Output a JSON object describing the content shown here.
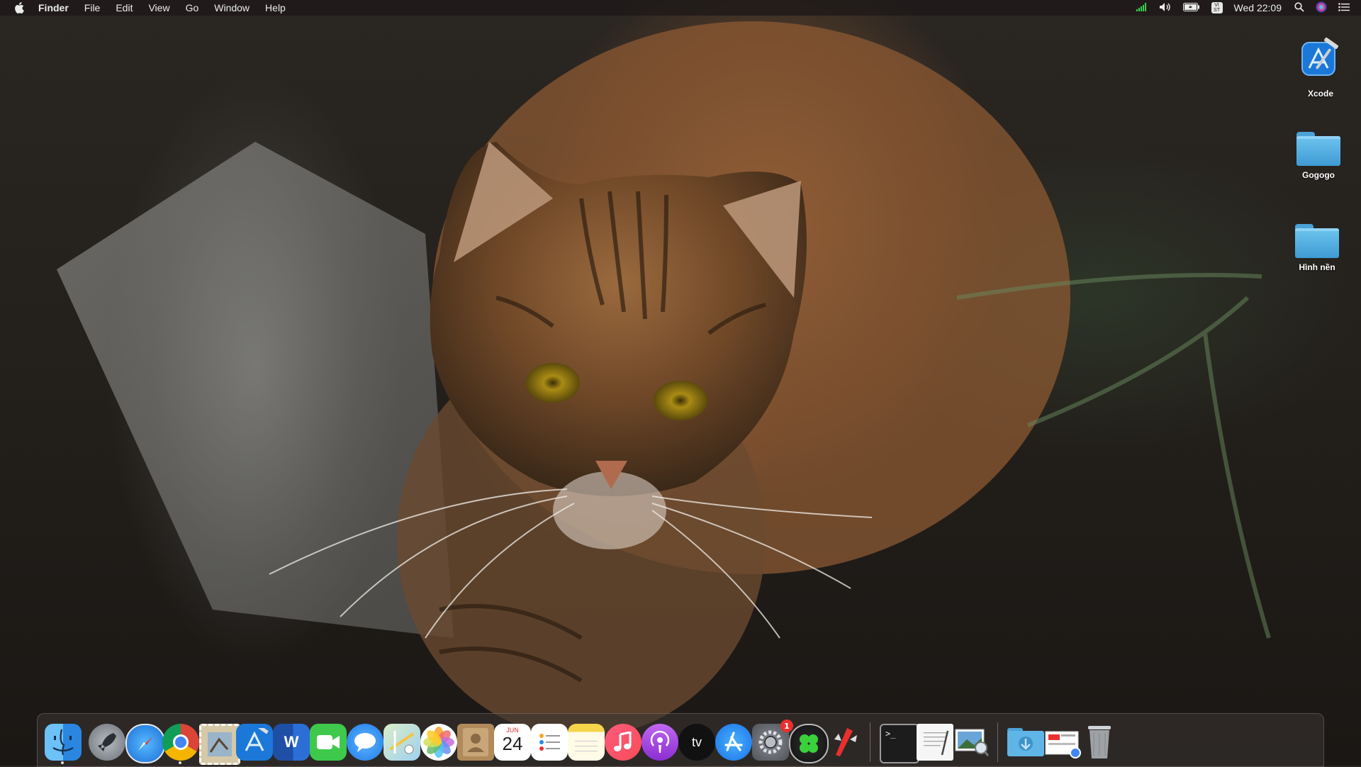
{
  "menubar": {
    "app_name": "Finder",
    "menus": [
      "File",
      "Edit",
      "View",
      "Go",
      "Window",
      "Help"
    ],
    "input_source": "VI ST",
    "clock": "Wed 22:09",
    "status_icons": [
      "wifi-signal-icon",
      "volume-icon",
      "battery-icon",
      "input-source-icon",
      "spotlight-icon",
      "siri-icon",
      "notification-center-icon"
    ]
  },
  "desktop": {
    "wallpaper": "Long-haired tabby cat crouching in dark grass",
    "icons": [
      {
        "label": "Xcode",
        "icon": "xcode-icon"
      },
      {
        "label": "Gogogo",
        "icon": "folder-icon"
      },
      {
        "label": "Hình nền",
        "icon": "folder-icon"
      }
    ]
  },
  "dock": {
    "apps": [
      {
        "name": "Finder",
        "icon": "finder-icon",
        "running": true
      },
      {
        "name": "Launchpad",
        "icon": "launchpad-icon"
      },
      {
        "name": "Safari",
        "icon": "safari-icon"
      },
      {
        "name": "Google Chrome",
        "icon": "chrome-icon",
        "running": true
      },
      {
        "name": "Mail Stamp",
        "icon": "stamp-icon"
      },
      {
        "name": "Xcode",
        "icon": "xcode-icon"
      },
      {
        "name": "Microsoft Word",
        "icon": "word-icon",
        "glyph": "W"
      },
      {
        "name": "FaceTime",
        "icon": "facetime-icon"
      },
      {
        "name": "Messages",
        "icon": "messages-icon"
      },
      {
        "name": "Maps",
        "icon": "maps-icon"
      },
      {
        "name": "Photos",
        "icon": "photos-icon"
      },
      {
        "name": "Contacts",
        "icon": "contacts-icon"
      },
      {
        "name": "Calendar",
        "icon": "calendar-icon",
        "month": "JUN",
        "day": "24"
      },
      {
        "name": "Reminders",
        "icon": "reminders-icon"
      },
      {
        "name": "Notes",
        "icon": "notes-icon"
      },
      {
        "name": "Music",
        "icon": "music-icon"
      },
      {
        "name": "Podcasts",
        "icon": "podcasts-icon"
      },
      {
        "name": "TV",
        "icon": "apple-tv-icon",
        "glyph": "tv"
      },
      {
        "name": "App Store",
        "icon": "app-store-icon"
      },
      {
        "name": "System Preferences",
        "icon": "system-preferences-icon",
        "badge": "1"
      },
      {
        "name": "Clover Configurator",
        "icon": "clover-icon"
      },
      {
        "name": "Kext Utility",
        "icon": "red-tool-icon"
      },
      {
        "name": "Terminal",
        "icon": "terminal-icon",
        "glyph": ">_"
      },
      {
        "name": "TextEdit",
        "icon": "textedit-icon"
      },
      {
        "name": "Preview",
        "icon": "preview-icon"
      },
      {
        "name": "Downloads",
        "icon": "downloads-folder-icon"
      },
      {
        "name": "Recent Document",
        "icon": "document-stack-icon"
      },
      {
        "name": "Trash",
        "icon": "trash-icon"
      }
    ]
  },
  "colors": {
    "menubar_bg": "#1e1a18",
    "folder_blue": "#4aa3d8",
    "badge_red": "#e8302f"
  }
}
